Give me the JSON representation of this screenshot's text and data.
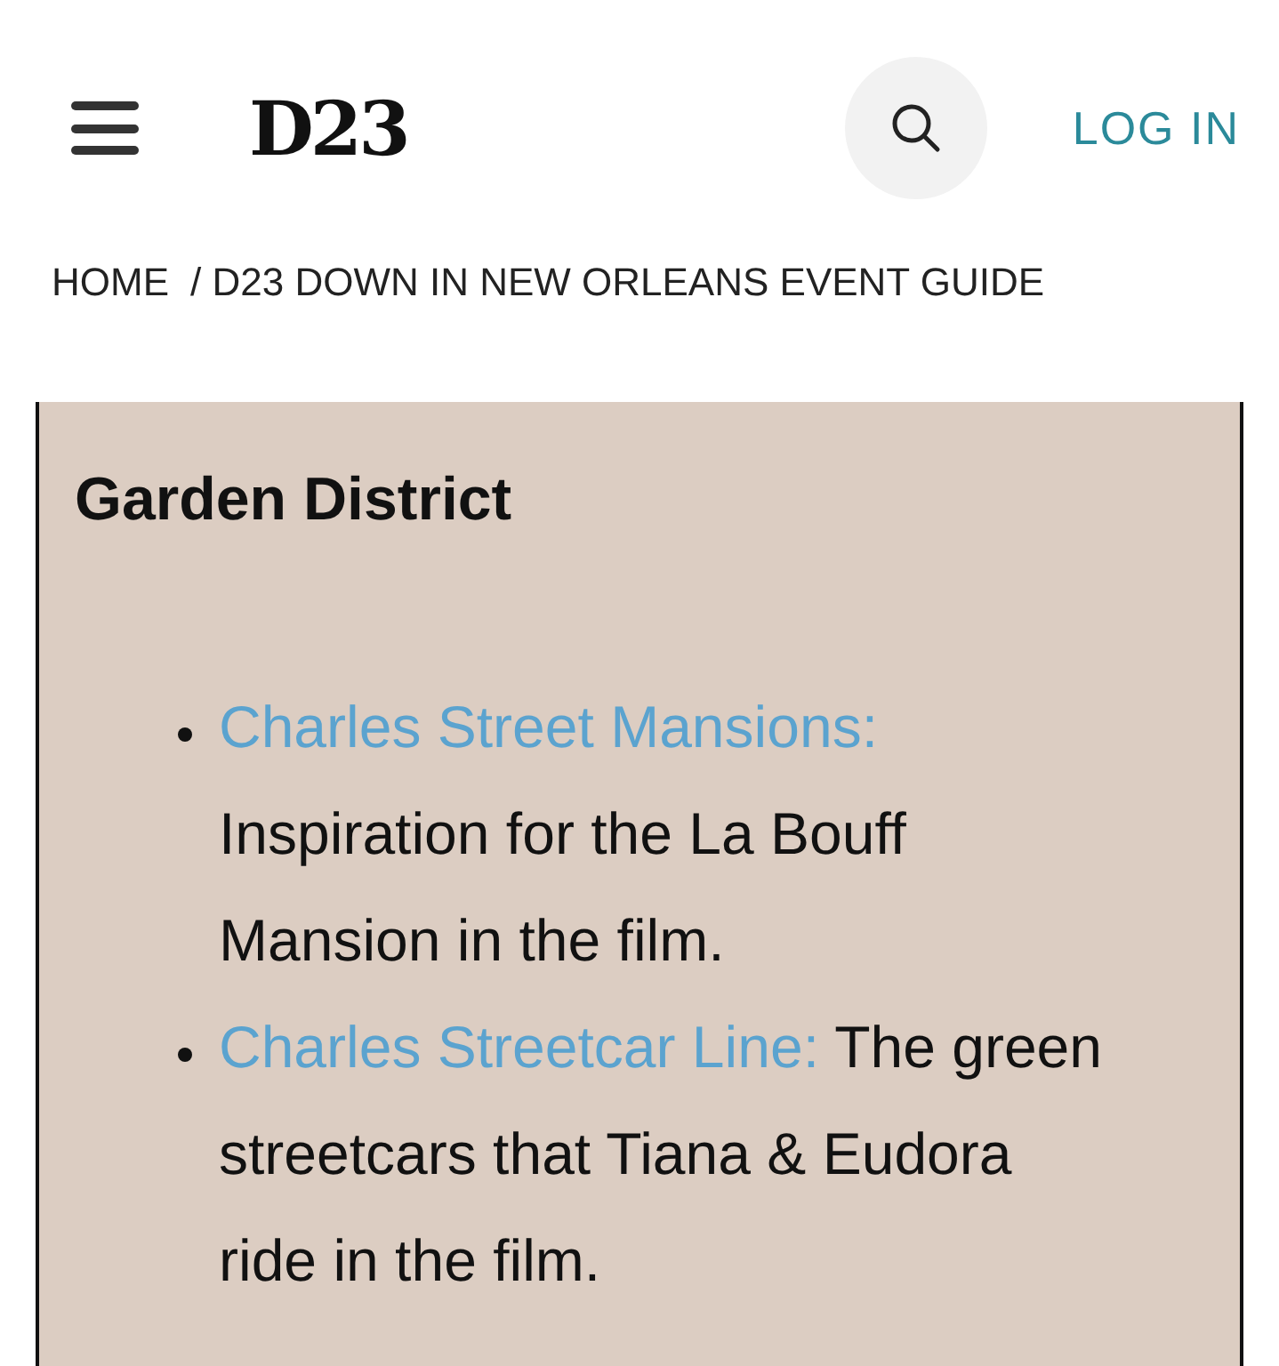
{
  "header": {
    "logo": "D23",
    "login": "LOG IN"
  },
  "breadcrumb": [
    {
      "label": "HOME"
    },
    {
      "label": "/ D23 DOWN IN NEW ORLEANS EVENT GUIDE"
    }
  ],
  "section": {
    "heading": "Garden District",
    "items": [
      {
        "link": "Charles Street Mansions:",
        "text": "Inspiration for the La Bouff Mansion in the film."
      },
      {
        "link": "Charles Streetcar Line:",
        "text": "The green streetcars that Tiana & Eudora ride in the film."
      }
    ]
  }
}
